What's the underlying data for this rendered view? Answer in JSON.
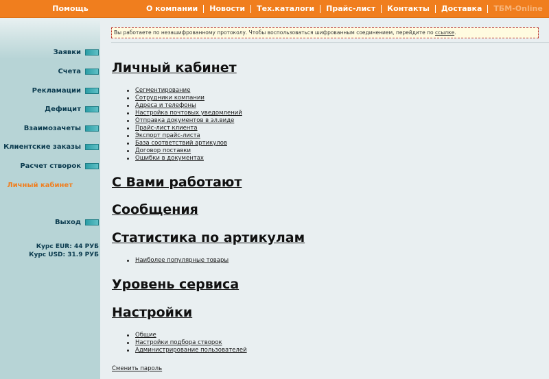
{
  "topnav": {
    "help": "Помощь",
    "items": [
      "О компании",
      "Новости",
      "Тех.каталоги",
      "Прайс-лист",
      "Контакты",
      "Доставка"
    ],
    "brand": "ТБМ-Online"
  },
  "sidebar": {
    "items": [
      "Заявки",
      "Счета",
      "Рекламации",
      "Дефицит",
      "Взаимозачеты",
      "Клиентские заказы",
      "Расчет створок"
    ],
    "active": "Личный кабинет",
    "logout": "Выход",
    "rate_eur": "Курс EUR: 44 РУБ",
    "rate_usd": "Курс USD: 31.9 РУБ"
  },
  "warning": {
    "text": "Вы работаете по незашифрованному протоколу. Чтобы воспользоваться шифрованным соединением, перейдите по ",
    "link": "ссылке",
    "tail": "."
  },
  "sections": {
    "cabinet": {
      "title": "Личный кабинет",
      "links": [
        "Сегментирование",
        "Сотрудники компании",
        "Адреса и телефоны",
        "Настройка почтовых уведомлений",
        "Отправка документов в эл.виде",
        "Прайс-лист клиента",
        "Экспорт прайс-листа",
        "База соответствий артикулов",
        "Договор поставки",
        "Ошибки в документах"
      ]
    },
    "working": {
      "title": "С Вами работают"
    },
    "messages": {
      "title": "Сообщения"
    },
    "stats": {
      "title": "Статистика по артикулам",
      "links": [
        "Наиболее популярные товары"
      ]
    },
    "service": {
      "title": "Уровень сервиса"
    },
    "settings": {
      "title": "Настройки",
      "links": [
        "Общие",
        "Настройки подбора створок",
        "Администрирование пользователей"
      ]
    }
  },
  "change_password": "Сменить пароль",
  "colors": {
    "accent": "#f07e1e",
    "sidebar": "#b7d4d6",
    "content": "#e9eff1",
    "marker": "#2b9da6"
  }
}
